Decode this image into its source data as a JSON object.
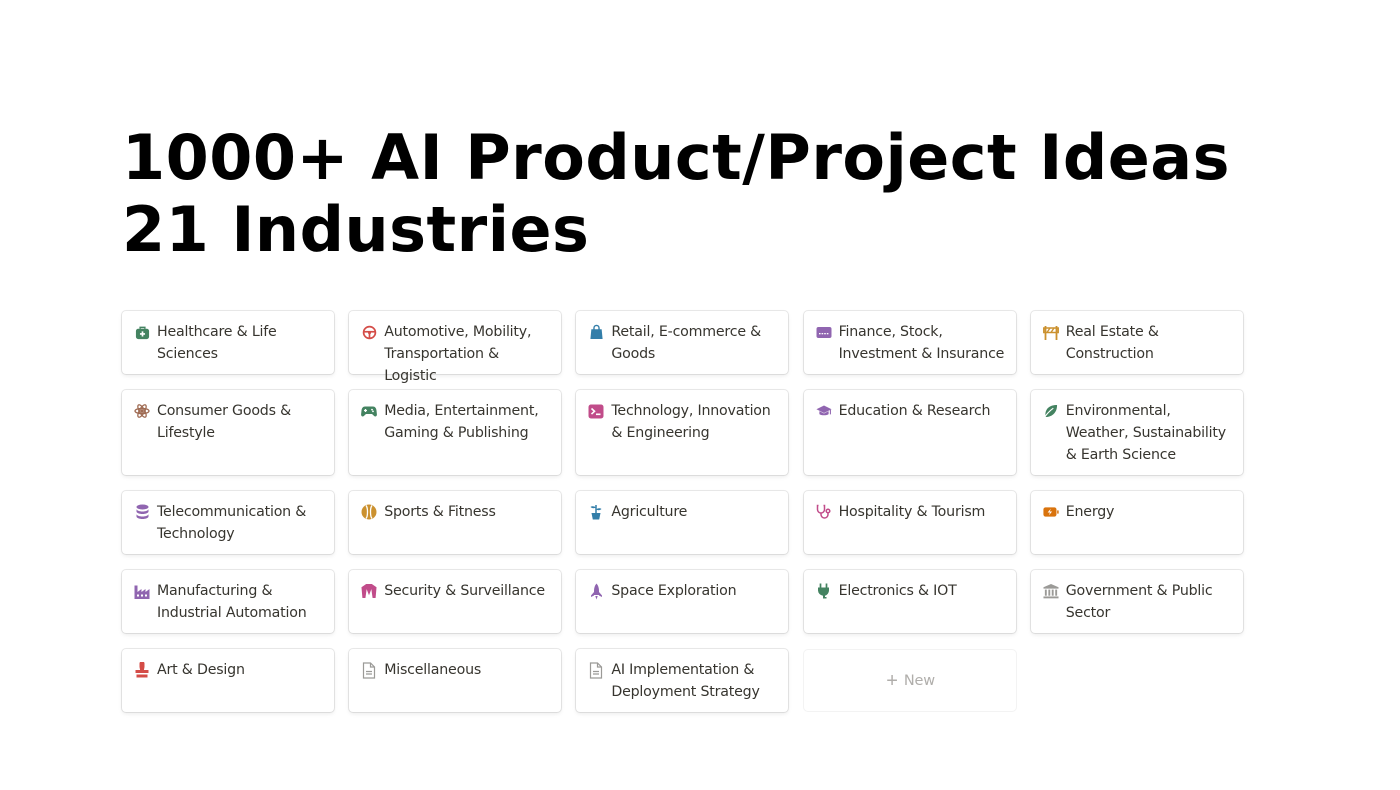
{
  "title": {
    "line1": "1000+ AI Product/Project Ideas",
    "line2": "21 Industries"
  },
  "cards": [
    {
      "label": "Healthcare & Life Sciences",
      "icon": "medical-bag-icon",
      "color": "#448361"
    },
    {
      "label": "Automotive, Mobility, Transportation & Logistic",
      "icon": "steering-wheel-icon",
      "color": "#d44c47"
    },
    {
      "label": "Retail, E-commerce & Goods",
      "icon": "shopping-bag-icon",
      "color": "#337ea9"
    },
    {
      "label": "Finance, Stock, Investment & Insurance",
      "icon": "credit-card-icon",
      "color": "#9065b0"
    },
    {
      "label": "Real Estate & Construction",
      "icon": "barrier-icon",
      "color": "#cb912f"
    },
    {
      "label": "Consumer Goods & Lifestyle",
      "icon": "atom-icon",
      "color": "#9f6b53"
    },
    {
      "label": "Media, Entertainment, Gaming & Publishing",
      "icon": "gamepad-icon",
      "color": "#448361"
    },
    {
      "label": "Technology, Innovation & Engineering",
      "icon": "terminal-icon",
      "color": "#c14c8a"
    },
    {
      "label": "Education & Research",
      "icon": "graduation-cap-icon",
      "color": "#9065b0"
    },
    {
      "label": "Environmental, Weather, Sustainability & Earth Science",
      "icon": "leaf-icon",
      "color": "#448361"
    },
    {
      "label": "Telecommunication & Technology",
      "icon": "database-icon",
      "color": "#9065b0"
    },
    {
      "label": "Sports & Fitness",
      "icon": "tennis-ball-icon",
      "color": "#cb912f"
    },
    {
      "label": "Agriculture",
      "icon": "plant-pot-icon",
      "color": "#337ea9"
    },
    {
      "label": "Hospitality & Tourism",
      "icon": "stethoscope-icon",
      "color": "#c14c8a"
    },
    {
      "label": "Energy",
      "icon": "battery-charging-icon",
      "color": "#d9730d"
    },
    {
      "label": "Manufacturing & Industrial Automation",
      "icon": "factory-icon",
      "color": "#9065b0"
    },
    {
      "label": "Security & Surveillance",
      "icon": "jacket-icon",
      "color": "#c14c8a"
    },
    {
      "label": "Space Exploration",
      "icon": "rocket-icon",
      "color": "#9065b0"
    },
    {
      "label": "Electronics & IOT",
      "icon": "plug-icon",
      "color": "#448361"
    },
    {
      "label": "Government & Public Sector",
      "icon": "bank-icon",
      "color": "#9b9a97"
    },
    {
      "label": "Art & Design",
      "icon": "stamp-icon",
      "color": "#d44c47"
    },
    {
      "label": "Miscellaneous",
      "icon": "document-icon",
      "color": "#9b9a97"
    },
    {
      "label": "AI Implementation & Deployment Strategy",
      "icon": "document-icon",
      "color": "#9b9a97"
    }
  ],
  "new_button": {
    "label": "New",
    "icon": "plus-icon"
  }
}
